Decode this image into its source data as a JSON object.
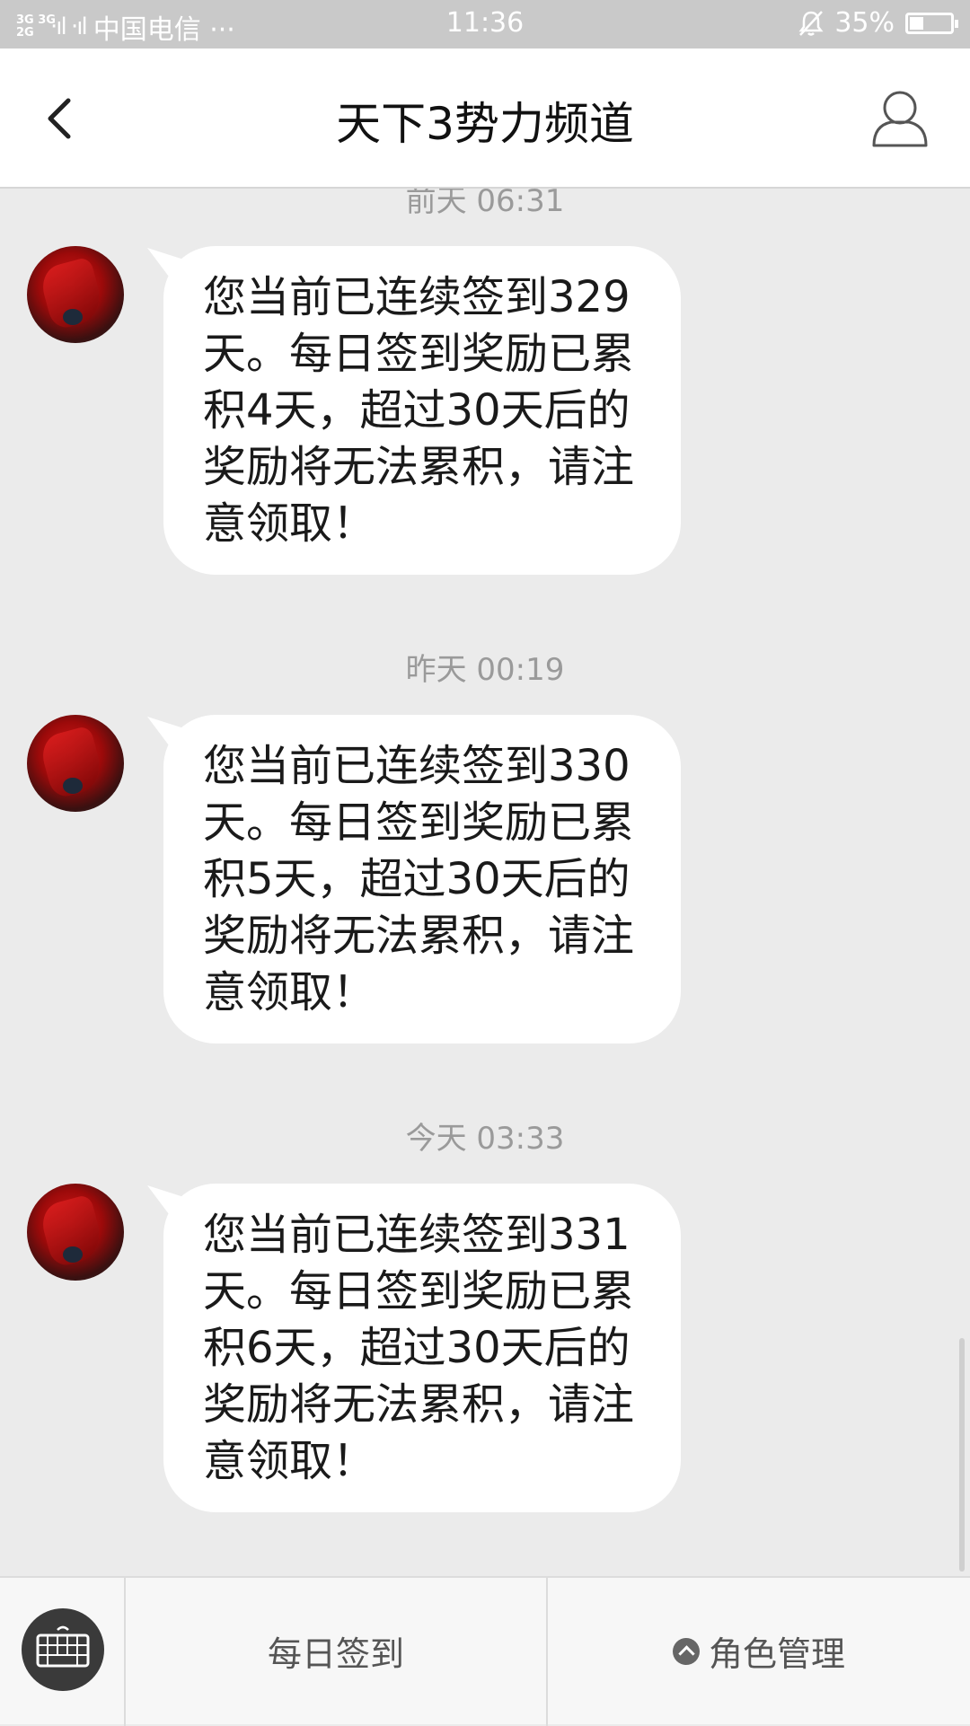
{
  "status_bar": {
    "network": "3G 3G\n2G",
    "signal": "·ıl ·ıl",
    "carrier": "中国电信 ···",
    "time": "11:36",
    "battery_percent": "35%",
    "battery_level": 0.35
  },
  "header": {
    "title": "天下3势力频道"
  },
  "messages": [
    {
      "timestamp": "前天 06:31",
      "text": "您当前已连续签到329天。每日签到奖励已累积4天，超过30天后的奖励将无法累积，请注意领取！"
    },
    {
      "timestamp": "昨天 00:19",
      "text": "您当前已连续签到330天。每日签到奖励已累积5天，超过30天后的奖励将无法累积，请注意领取！"
    },
    {
      "timestamp": "今天 03:33",
      "text": "您当前已连续签到331天。每日签到奖励已累积6天，超过30天后的奖励将无法累积，请注意领取！"
    }
  ],
  "bottom_bar": {
    "daily_checkin_label": "每日签到",
    "role_management_label": "角色管理"
  },
  "icons": {
    "back": "chevron-left-icon",
    "profile": "user-icon",
    "keyboard": "keyboard-icon",
    "mute": "bell-off-icon",
    "menu_up": "chevron-up-icon"
  }
}
